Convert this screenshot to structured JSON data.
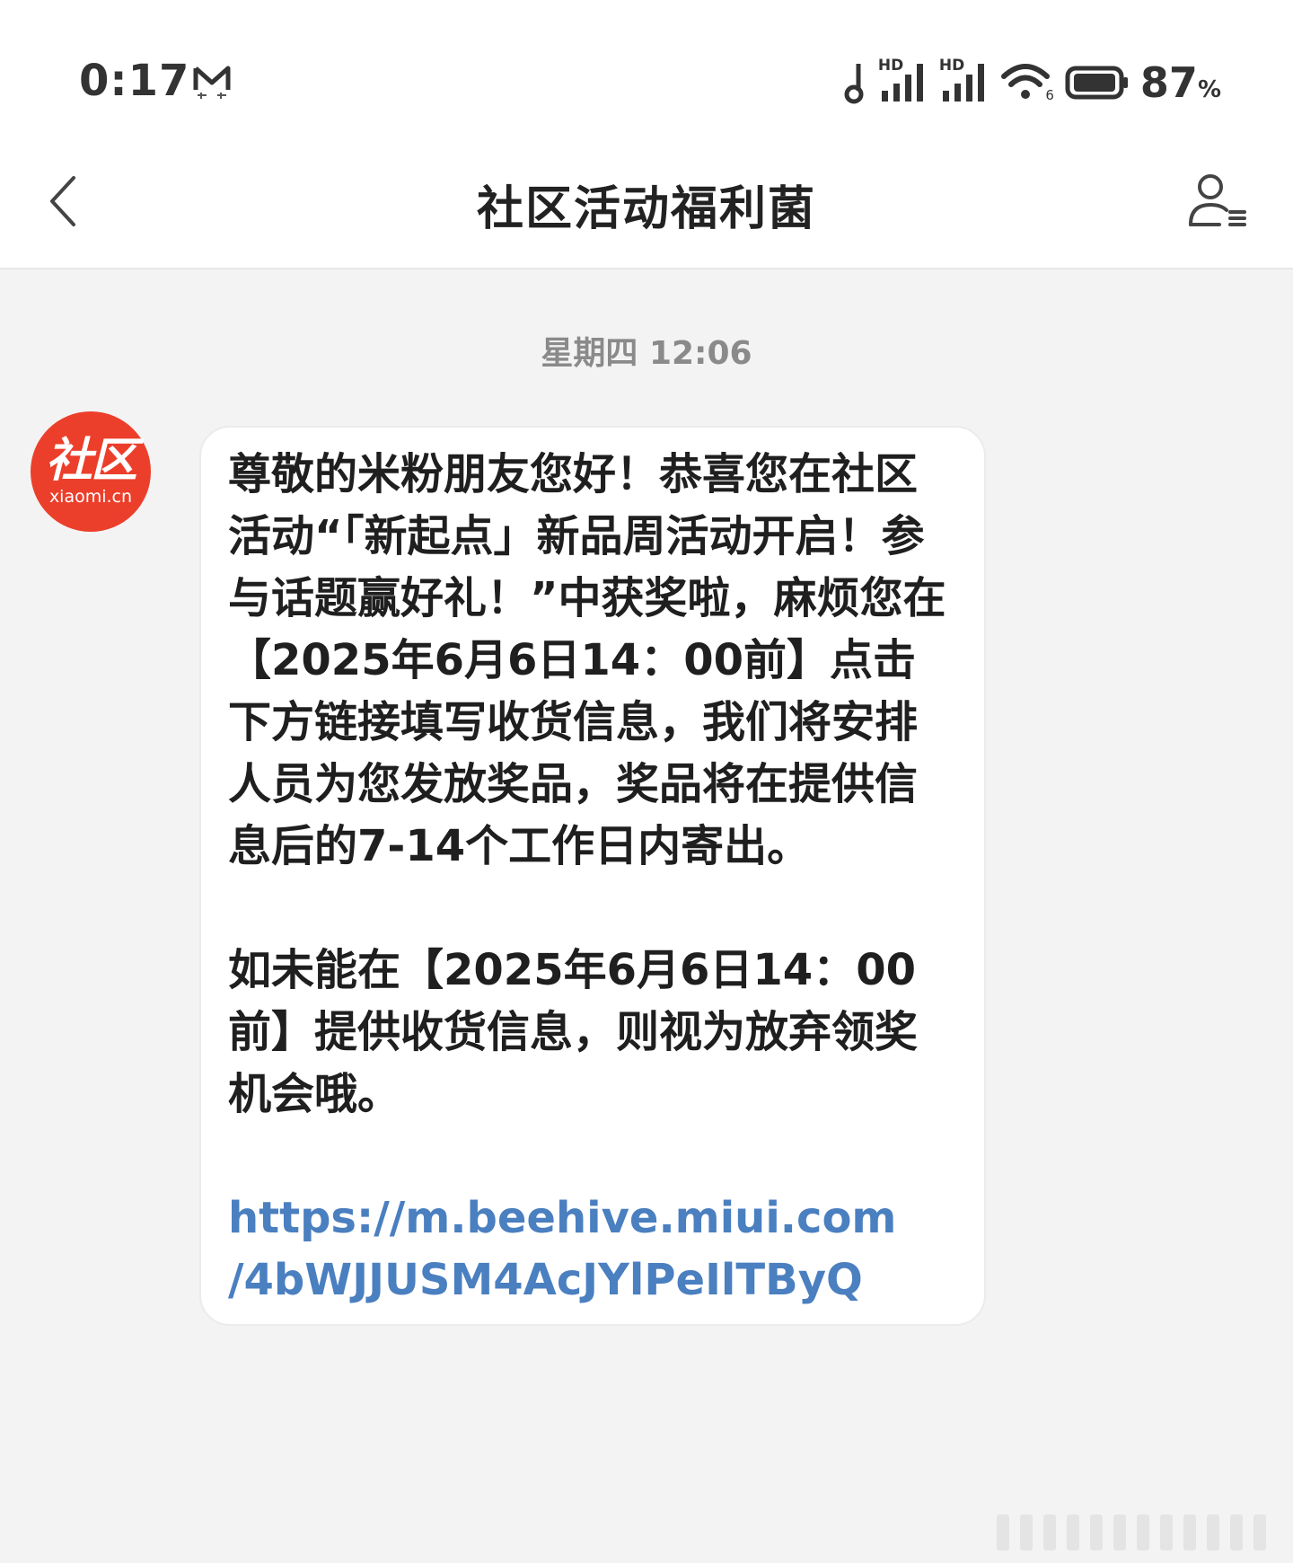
{
  "status_bar": {
    "time": "0:17",
    "battery_percent": "87",
    "battery_unit": "%",
    "wifi_badge": "6",
    "network_badges": [
      "HD",
      "HD"
    ]
  },
  "header": {
    "title": "社区活动福利菌"
  },
  "conversation": {
    "timestamp": "星期四 12:06",
    "sender_avatar": {
      "main": "社区",
      "sub": "xiaomi.cn"
    },
    "message": {
      "paragraph_1": "尊敬的米粉朋友您好！恭喜您在社区活动“「新起点」新品周活动开启！参与话题赢好礼！”中获奖啦，麻烦您在【2025年6月6日14：00前】点击下方链接填写收货信息，我们将安排人员为您发放奖品，奖品将在提供信息后的7-14个工作日内寄出。",
      "paragraph_2": "如未能在【2025年6月6日14：00前】提供收货信息，则视为放弃领奖机会哦。",
      "link_line_1": "https://m.beehive.miui.com",
      "link_line_2": "/4bWJJUSM4AcJYlPeIlTByQ"
    }
  },
  "colors": {
    "accent_link": "#4a7fc0",
    "avatar_bg": "#ec3f2b",
    "background": "#f3f3f3"
  }
}
